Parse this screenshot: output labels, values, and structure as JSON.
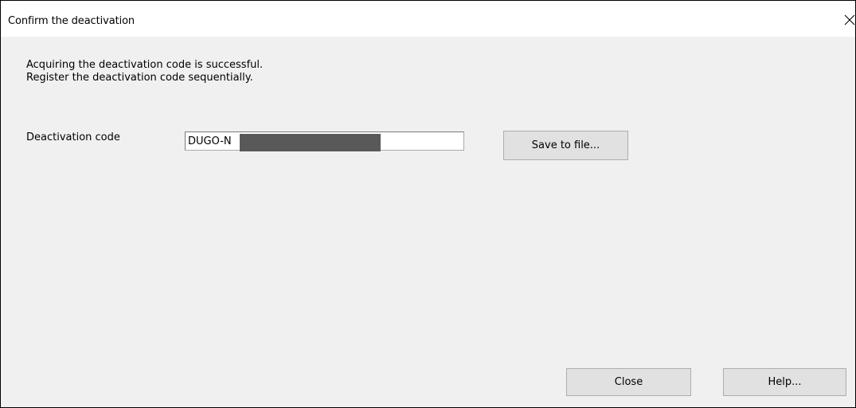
{
  "dialog": {
    "title": "Confirm the deactivation",
    "message_lines": [
      "Acquiring the deactivation code is successful.",
      "Register the deactivation code sequentially."
    ],
    "deactivation_code_label": "Deactivation code",
    "deactivation_code_value": "DUGO-N",
    "save_button_label": "Save to file...",
    "close_button_label": "Close",
    "help_button_label": "Help..."
  },
  "icons": {
    "close": "close-icon"
  },
  "colors": {
    "title_bar_bg": "#ffffff",
    "dialog_bg": "#f0f0f0",
    "button_bg": "#e1e1e1",
    "button_border": "#adadad",
    "redaction": "#595959"
  }
}
